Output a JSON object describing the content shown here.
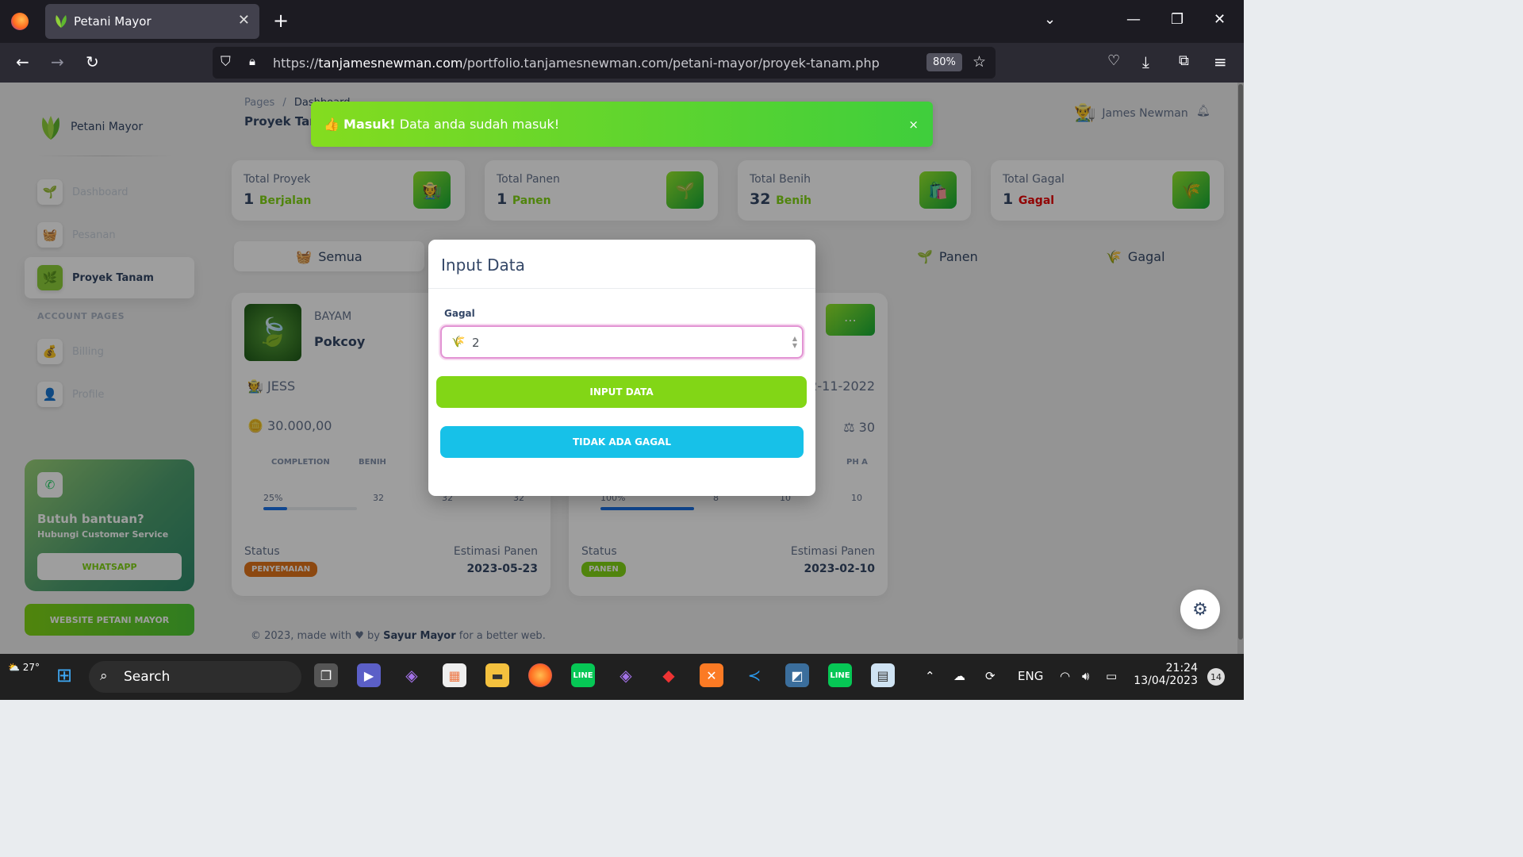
{
  "browser": {
    "tab_title": "Petani Mayor",
    "url_prefix": "https://",
    "url_domain": "tanjamesnewman.com",
    "url_path": "/portfolio.tanjamesnewman.com/petani-mayor/proyek-tanam.php",
    "zoom": "80%"
  },
  "sidebar": {
    "brand": "Petani Mayor",
    "items": [
      {
        "label": "Dashboard"
      },
      {
        "label": "Pesanan"
      },
      {
        "label": "Proyek Tanam"
      }
    ],
    "account_title": "ACCOUNT PAGES",
    "account_items": [
      {
        "label": "Billing"
      },
      {
        "label": "Profile"
      }
    ],
    "help": {
      "title": "Butuh bantuan?",
      "subtitle": "Hubungi Customer Service",
      "button": "WHATSAPP"
    },
    "website_button": "WEBSITE PETANI MAYOR"
  },
  "header": {
    "crumb_root": "Pages",
    "crumb_sep": "/",
    "crumb_current": "Dashboard",
    "title": "Proyek Tanam",
    "user": "James Newman"
  },
  "stats": [
    {
      "title": "Total Proyek",
      "value": "1",
      "unit": "Berjalan"
    },
    {
      "title": "Total Panen",
      "value": "1",
      "unit": "Panen"
    },
    {
      "title": "Total Benih",
      "value": "32",
      "unit": "Benih"
    },
    {
      "title": "Total Gagal",
      "value": "1",
      "unit": "Gagal"
    }
  ],
  "filters": {
    "all": "Semua",
    "panen": "Panen",
    "gagal": "Gagal"
  },
  "cards": [
    {
      "category": "BAYAM",
      "name": "Pokcoy",
      "owner": "JESS",
      "price": "30.000,00",
      "headers": [
        "COMPLETION",
        "BENIH"
      ],
      "completion": "25%",
      "completion_value": 25,
      "c1": "32",
      "c2": "32",
      "c3": "32",
      "status_label": "Status",
      "status": "PENYEMAIAN",
      "status_color": "#e3741b",
      "estimasi_label": "Estimasi Panen",
      "estimasi": "2023-05-23"
    },
    {
      "date_partial": "2-11-2022",
      "weight": "30",
      "header_pha": "PH A",
      "completion": "100%",
      "completion_value": 100,
      "c1": "8",
      "c2": "10",
      "c3": "10",
      "status_label": "Status",
      "status": "PANEN",
      "status_color": "#82d616",
      "estimasi_label": "Estimasi Panen",
      "estimasi": "2023-02-10"
    }
  ],
  "footer": {
    "pre": "© 2023, made with",
    "heart": "♥",
    "by": "by",
    "brand": "Sayur Mayor",
    "post": "for a better web."
  },
  "alert": {
    "bold": "Masuk!",
    "text": "Data anda sudah masuk!",
    "close": "×"
  },
  "modal": {
    "title": "Input Data",
    "field_label": "Gagal",
    "field_value": "2",
    "submit": "INPUT DATA",
    "secondary": "TIDAK ADA GAGAL"
  },
  "taskbar": {
    "weather": "27°",
    "search": "Search",
    "lang": "ENG",
    "time": "21:24",
    "date": "13/04/2023",
    "notifications": "14"
  }
}
